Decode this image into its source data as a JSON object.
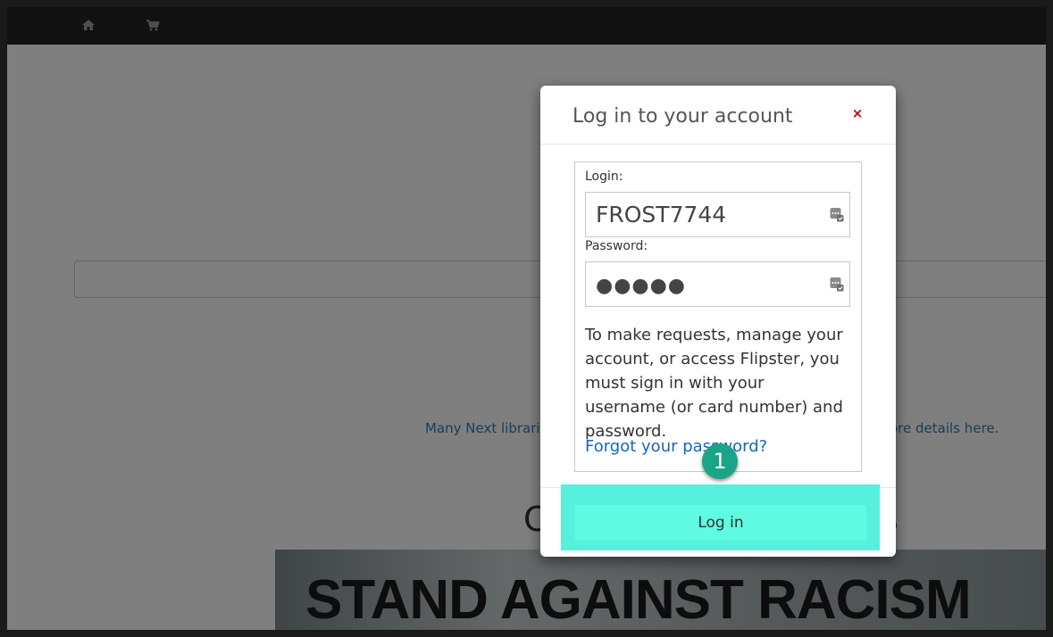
{
  "nav": {
    "home_icon": "home-icon",
    "cart_icon": "cart-icon"
  },
  "background": {
    "notice_left": "Many Next librarie",
    "notice_right": "ore details here.",
    "heading_left": "C",
    "heading_right": "s",
    "banner_text": "STAND AGAINST RACISM"
  },
  "modal": {
    "title": "Log in to your account",
    "close_glyph": "×",
    "login_label": "Login:",
    "login_value": "FROST7744",
    "password_label": "Password:",
    "password_dots": "●●●●●",
    "help_text": "To make requests, manage your account, or access Flipster, you must sign in with your username (or card number) and password.",
    "forgot_link": "Forgot your password?",
    "login_button": "Log in"
  },
  "annotation": {
    "step_number": "1",
    "highlight_color": "#57f0dd",
    "badge_color": "#1aa589"
  },
  "colors": {
    "nav_bg": "#222222",
    "link": "#1565c0",
    "close": "#cc0000"
  }
}
